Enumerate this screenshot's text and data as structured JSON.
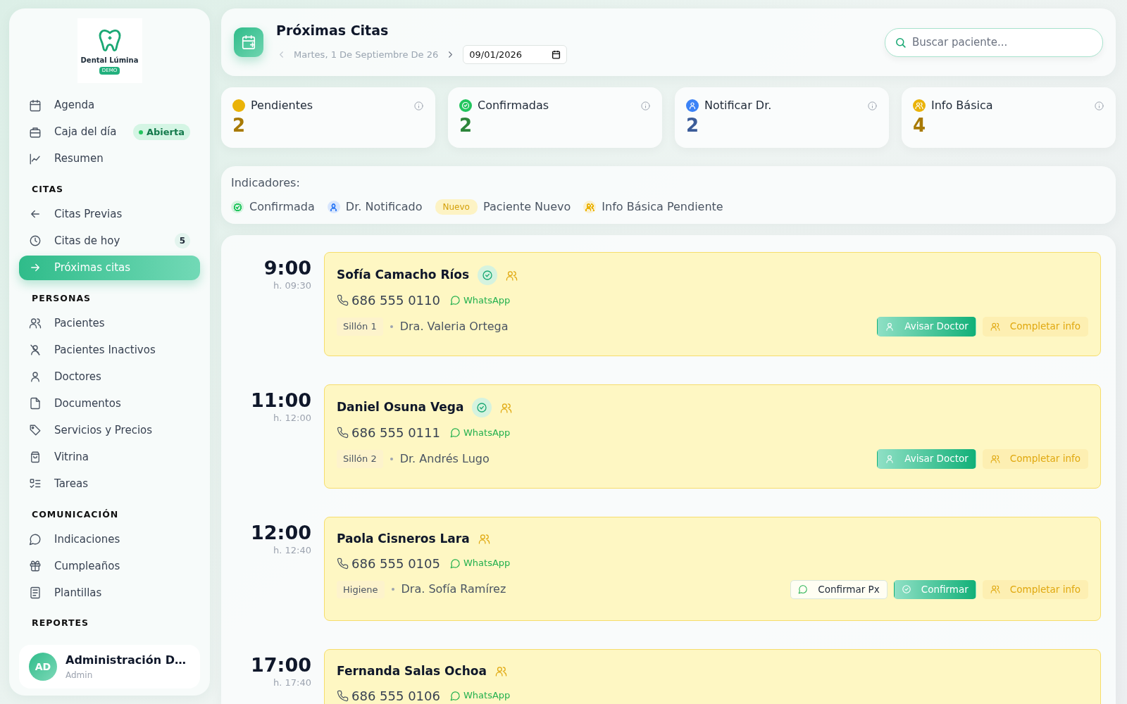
{
  "sidebar": {
    "logo": {
      "name": "Dental Lúmina",
      "tag": "DEMO"
    },
    "sections": [
      {
        "items": [
          {
            "label": "Agenda",
            "selected": false
          },
          {
            "label": "Caja del día",
            "selected": false,
            "status": "Abierta"
          },
          {
            "label": "Resumen",
            "selected": false
          }
        ]
      },
      {
        "heading": "CITAS",
        "items": [
          {
            "label": "Citas Previas",
            "selected": false
          },
          {
            "label": "Citas de hoy",
            "selected": false,
            "count": "5"
          },
          {
            "label": "Próximas citas",
            "selected": true
          }
        ]
      },
      {
        "heading": "PERSONAS",
        "items": [
          {
            "label": "Pacientes",
            "selected": false
          },
          {
            "label": "Pacientes Inactivos",
            "selected": false
          },
          {
            "label": "Doctores",
            "selected": false
          },
          {
            "label": "Documentos",
            "selected": false
          },
          {
            "label": "Servicios y Precios",
            "selected": false
          },
          {
            "label": "Vitrina",
            "selected": false
          },
          {
            "label": "Tareas",
            "selected": false
          }
        ]
      },
      {
        "heading": "COMUNICACIÓN",
        "items": [
          {
            "label": "Indicaciones",
            "selected": false
          },
          {
            "label": "Cumpleaños",
            "selected": false
          },
          {
            "label": "Plantillas",
            "selected": false
          }
        ]
      },
      {
        "heading": "REPORTES"
      }
    ],
    "user": {
      "initials": "AD",
      "name": "Administración D…",
      "role": "Admin"
    }
  },
  "header": {
    "title": "Próximas Citas",
    "date_label": "Martes, 1 De Septiembre De 26",
    "date_value": "09/01/2026",
    "search": {
      "placeholder": "Buscar paciente..."
    }
  },
  "stats": [
    {
      "label": "Pendientes",
      "value": "2",
      "color": "#eab308"
    },
    {
      "label": "Confirmadas",
      "value": "2",
      "color": "#22c55e"
    },
    {
      "label": "Notificar Dr.",
      "value": "2",
      "color": "#3b82f6"
    },
    {
      "label": "Info Básica",
      "value": "4",
      "color": "#eab308"
    }
  ],
  "legend": {
    "title": "Indicadores:",
    "items": [
      {
        "kind": "icon",
        "label": "Confirmada",
        "color": "#22c55e"
      },
      {
        "kind": "icon",
        "label": "Dr. Notificado",
        "color": "#3b82f6"
      },
      {
        "kind": "tag",
        "tag": "Nuevo",
        "label": "Paciente Nuevo"
      },
      {
        "kind": "icon",
        "label": "Info Básica Pendiente",
        "color": "#eab308"
      }
    ]
  },
  "appointments": [
    {
      "time": "9:00",
      "end": "h. 09:30",
      "patient": "Sofía Camacho Ríos",
      "confirmed": true,
      "info_pending": true,
      "phone": "686 555 0110",
      "whatsapp": "WhatsApp",
      "chair": "Sillón 1",
      "doctor": "Dra. Valeria Ortega",
      "actions": [
        {
          "kind": "notify",
          "label": "Avisar Doctor"
        },
        {
          "kind": "complete",
          "label": "Completar info"
        }
      ]
    },
    {
      "time": "11:00",
      "end": "h. 12:00",
      "patient": "Daniel Osuna Vega",
      "confirmed": true,
      "info_pending": true,
      "phone": "686 555 0111",
      "whatsapp": "WhatsApp",
      "chair": "Sillón 2",
      "doctor": "Dr. Andrés Lugo",
      "actions": [
        {
          "kind": "notify",
          "label": "Avisar Doctor"
        },
        {
          "kind": "complete",
          "label": "Completar info"
        }
      ]
    },
    {
      "time": "12:00",
      "end": "h. 12:40",
      "patient": "Paola Cisneros Lara",
      "confirmed": false,
      "info_pending": true,
      "phone": "686 555 0105",
      "whatsapp": "WhatsApp",
      "chair": "Higiene",
      "doctor": "Dra. Sofía Ramírez",
      "actions": [
        {
          "kind": "message",
          "label": "Confirmar Px"
        },
        {
          "kind": "confirm",
          "label": "Confirmar"
        },
        {
          "kind": "complete",
          "label": "Completar info"
        }
      ]
    },
    {
      "time": "17:00",
      "end": "h. 17:40",
      "patient": "Fernanda Salas Ochoa",
      "confirmed": false,
      "info_pending": true,
      "phone": "686 555 0106",
      "whatsapp": "WhatsApp"
    }
  ]
}
